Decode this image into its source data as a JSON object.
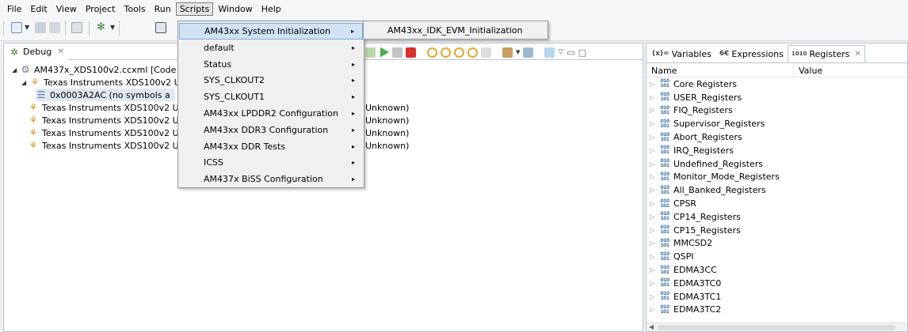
{
  "menubar": {
    "items": [
      "File",
      "Edit",
      "View",
      "Project",
      "Tools",
      "Run",
      "Scripts",
      "Window",
      "Help"
    ],
    "open_item": "Scripts"
  },
  "scripts_menu": {
    "items": [
      {
        "label": "AM43xx System Initialization",
        "has_submenu": true
      },
      {
        "label": "default",
        "has_submenu": true
      },
      {
        "label": "Status",
        "has_submenu": true
      },
      {
        "label": "SYS_CLKOUT2",
        "has_submenu": true
      },
      {
        "label": "SYS_CLKOUT1",
        "has_submenu": true
      },
      {
        "label": "AM43xx LPDDR2 Configuration",
        "has_submenu": true
      },
      {
        "label": "AM43xx DDR3 Configuration",
        "has_submenu": true
      },
      {
        "label": "AM43xx DDR Tests",
        "has_submenu": true
      },
      {
        "label": "ICSS",
        "has_submenu": true
      },
      {
        "label": "AM437x BiSS Configuration",
        "has_submenu": true
      }
    ],
    "highlighted": "AM43xx System Initialization"
  },
  "submenu": {
    "items": [
      "AM43xx_IDK_EVM_Initialization"
    ]
  },
  "debug_view": {
    "tab_label": "Debug",
    "tree": [
      {
        "label": "AM437x_XDS100v2.ccxml [Code Co",
        "suffix": ""
      },
      {
        "label": "Texas Instruments XDS100v2 US",
        "suffix": ""
      },
      {
        "label": "0x0003A2AC  (no symbols a",
        "suffix": ""
      },
      {
        "label": "Texas Instruments XDS100v2 US",
        "suffix": "Unknown)"
      },
      {
        "label": "Texas Instruments XDS100v2 US",
        "suffix": "Unknown)"
      },
      {
        "label": "Texas Instruments XDS100v2 US",
        "suffix": "Unknown)"
      },
      {
        "label": "Texas Instruments XDS100v2 US",
        "suffix": "Unknown)"
      }
    ]
  },
  "registers_view": {
    "tabs": [
      {
        "glyph": "(x)=",
        "label": "Variables"
      },
      {
        "glyph": "6€",
        "label": "Expressions"
      },
      {
        "glyph": "1010",
        "label": "Registers"
      }
    ],
    "active_tab": "Registers",
    "columns": {
      "name": "Name",
      "value": "Value"
    },
    "rows": [
      "Core Registers",
      "USER_Registers",
      "FIQ_Registers",
      "Supervisor_Registers",
      "Abort_Registers",
      "IRQ_Registers",
      "Undefined_Registers",
      "Monitor_Mode_Registers",
      "All_Banked_Registers",
      "CPSR",
      "CP14_Registers",
      "CP15_Registers",
      "MMCSD2",
      "QSPI",
      "EDMA3CC",
      "EDMA3TC0",
      "EDMA3TC1",
      "EDMA3TC2"
    ]
  },
  "icons": {
    "debug_tab": "debug-bug-icon",
    "register_group": "register-group-icon",
    "submenu_arrow": "▸",
    "twisty_collapsed": "▷",
    "twisty_expanded": "◢"
  },
  "colors": {
    "menu_highlight": "#d1e2f2",
    "menu_highlight_border": "#78aee5",
    "panel_border": "#b7c3d0"
  }
}
